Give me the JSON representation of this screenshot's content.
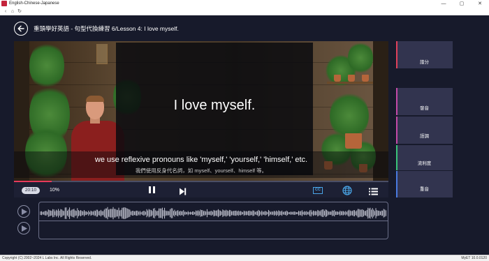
{
  "window": {
    "title": "English-Chinese-Japanese",
    "minimize_glyph": "—",
    "maximize_glyph": "▢",
    "close_glyph": "✕"
  },
  "nav": {
    "back_glyph": "‹",
    "home_glyph": "⌂",
    "refresh_glyph": "↻"
  },
  "header": {
    "lesson_title": "重頭學好英語 - 句型代換練習 6/Lesson 4: I love myself."
  },
  "video": {
    "sentence": "I love myself.",
    "subtitle_en": "we use reflexive pronouns like 'myself,' 'yourself,' 'himself,' etc.",
    "subtitle_zh": "我們使用反身代名詞，如 myself、yourself、himself 等。",
    "progress": 0.1
  },
  "controls": {
    "time": "20:10",
    "speed": "10%",
    "cc_label": "CC"
  },
  "side_buttons": [
    {
      "label": "譜分",
      "accent": "#e0405a"
    },
    {
      "label": "發音",
      "accent": "#c44aa8"
    },
    {
      "label": "語調",
      "accent": "#c44aa8"
    },
    {
      "label": "流利度",
      "accent": "#3ac47a"
    },
    {
      "label": "重音",
      "accent": "#4a7ae0"
    }
  ],
  "footer": {
    "copyright": "Copyright (C) 2002~2024 L Labs Inc. All Rights Reserved.",
    "version": "MyET 10.0.0120"
  },
  "colors": {
    "background": "#171a2b",
    "accent_progress": "#e53a5c",
    "accent_cc": "#4aa6e8"
  }
}
